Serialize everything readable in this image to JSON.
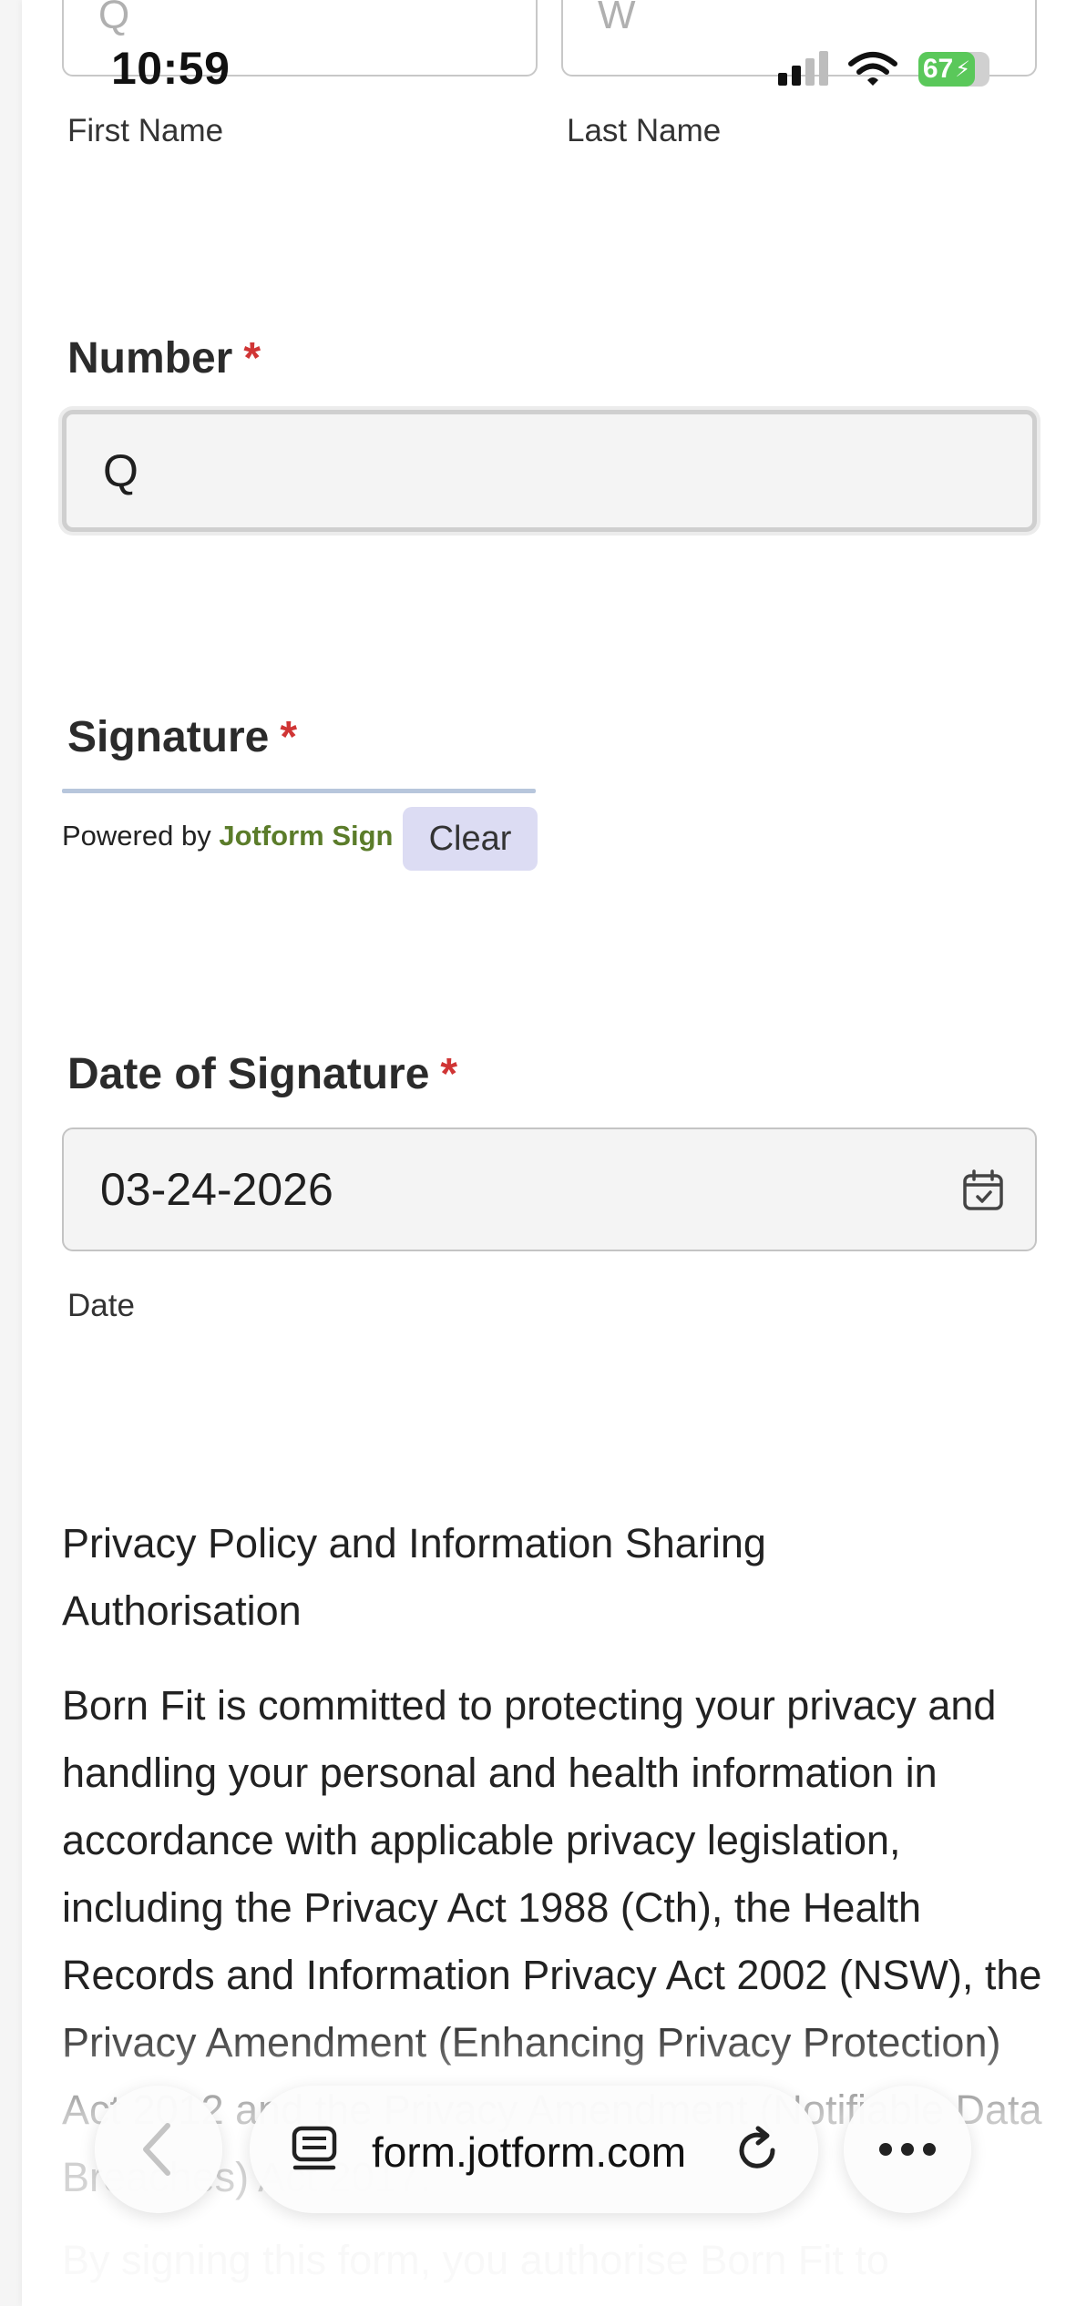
{
  "status_bar": {
    "time": "10:59",
    "battery": "67"
  },
  "name_fields": {
    "first_value": "Q",
    "last_value": "W",
    "first_label": "First Name",
    "last_label": "Last Name"
  },
  "number_field": {
    "label": "Number",
    "required_mark": "*",
    "value": "Q"
  },
  "signature_field": {
    "label": "Signature",
    "required_mark": "*",
    "powered_by": "Powered by ",
    "brand": "Jotform Sign",
    "clear_label": "Clear"
  },
  "date_field": {
    "label": "Date of Signature",
    "required_mark": "*",
    "value": "03-24-2026",
    "sublabel": "Date"
  },
  "privacy": {
    "title": "Privacy Policy and Information Sharing Authorisation",
    "body": "Born Fit is committed to protecting your privacy and handling your personal and health information in accordance with applicable privacy legislation, including the Privacy Act 1988 (Cth), the Health Records and Information Privacy Act 2002 (NSW), the Privacy Amendment (Enhancing Privacy Protection) Act 2012 and the Privacy Amendment (Notifiable Data Breaches) Act 2017.",
    "faded_line": "By signing this form, you authorise Born Fit to"
  },
  "browser_bar": {
    "url": "form.jotform.com"
  }
}
